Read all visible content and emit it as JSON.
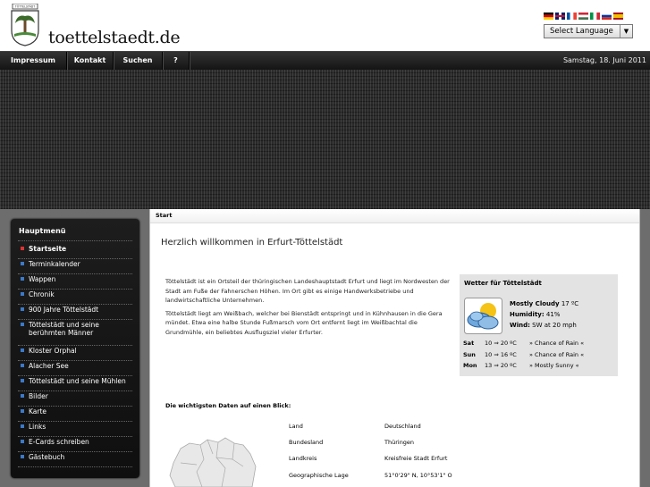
{
  "header": {
    "site_title": "toettelstaedt.de",
    "logo_icon": "coat-of-arms-icon",
    "language_select": {
      "value": "Select Language"
    },
    "flags": [
      {
        "name": "german-flag-icon",
        "colors": [
          "#000000",
          "#dd0000",
          "#ffce00"
        ]
      },
      {
        "name": "uk-flag-icon",
        "colors": [
          "#012169",
          "#ffffff",
          "#c8102e"
        ]
      },
      {
        "name": "french-flag-icon",
        "colors": [
          "#0055a4",
          "#ffffff",
          "#ef4135"
        ]
      },
      {
        "name": "hungarian-flag-icon",
        "colors": [
          "#ce2939",
          "#ffffff",
          "#477050"
        ]
      },
      {
        "name": "italian-flag-icon",
        "colors": [
          "#009246",
          "#ffffff",
          "#ce2b37"
        ]
      },
      {
        "name": "russian-flag-icon",
        "colors": [
          "#ffffff",
          "#0039a6",
          "#d52b1e"
        ]
      },
      {
        "name": "spanish-flag-icon",
        "colors": [
          "#aa151b",
          "#f1bf00",
          "#aa151b"
        ]
      }
    ]
  },
  "nav": {
    "items": [
      "Impressum",
      "Kontakt",
      "Suchen",
      "?"
    ],
    "date": "Samstag, 18. Juni 2011"
  },
  "sidebar": {
    "title": "Hauptmenü",
    "items": [
      {
        "label": "Startseite",
        "active": true
      },
      {
        "label": "Terminkalender"
      },
      {
        "label": "Wappen"
      },
      {
        "label": "Chronik"
      },
      {
        "label": "900 Jahre Töttelstädt"
      },
      {
        "label": "Töttelstädt und seine berühmten Männer"
      },
      {
        "label": "Kloster Orphal"
      },
      {
        "label": "Alacher See"
      },
      {
        "label": "Töttelstädt und seine Mühlen"
      },
      {
        "label": "Bilder"
      },
      {
        "label": "Karte"
      },
      {
        "label": "Links"
      },
      {
        "label": "E-Cards schreiben"
      },
      {
        "label": "Gästebuch"
      }
    ]
  },
  "main": {
    "breadcrumb": "Start",
    "title": "Herzlich willkommen in Erfurt-Töttelstädt",
    "paragraphs": [
      "Töttelstädt ist ein Ortsteil der thüringischen Landeshauptstadt Erfurt und liegt im Nordwesten der Stadt am Fuße der Fahnerschen Höhen. Im Ort gibt es einige Handwerksbetriebe und landwirtschaftliche Unternehmen.",
      "Töttelstädt liegt am Weißbach, welcher bei Bienstädt entspringt und in Kühnhausen in die Gera mündet. Etwa eine halbe Stunde Fußmarsch vom Ort entfernt liegt im Weißbachtal die Grundmühle, ein beliebtes Ausflugsziel vieler Erfurter."
    ],
    "facts_title": "Die wichtigsten Daten auf einen Blick:",
    "facts": [
      {
        "label": "Land",
        "value": "Deutschland"
      },
      {
        "label": "Bundesland",
        "value": "Thüringen"
      },
      {
        "label": "Landkreis",
        "value": "Kreisfreie Stadt Erfurt"
      },
      {
        "label": "Geographische Lage",
        "value": "51°0'29\" N, 10°53'1\" O"
      }
    ]
  },
  "weather": {
    "title": "Wetter für Töttelstädt",
    "icon": "mostly-cloudy-icon",
    "condition": "Mostly Cloudy",
    "temp": "17 ºC",
    "humidity_label": "Humidity:",
    "humidity": "41%",
    "wind_label": "Wind:",
    "wind": "SW at 20 mph",
    "forecast": [
      {
        "day": "Sat",
        "temps": "10 ⇒ 20 ºC",
        "cond": "» Chance of Rain «"
      },
      {
        "day": "Sun",
        "temps": "10 ⇒ 16 ºC",
        "cond": "» Chance of Rain «"
      },
      {
        "day": "Mon",
        "temps": "13 ⇒ 20 ºC",
        "cond": "» Mostly Sunny «"
      }
    ]
  }
}
